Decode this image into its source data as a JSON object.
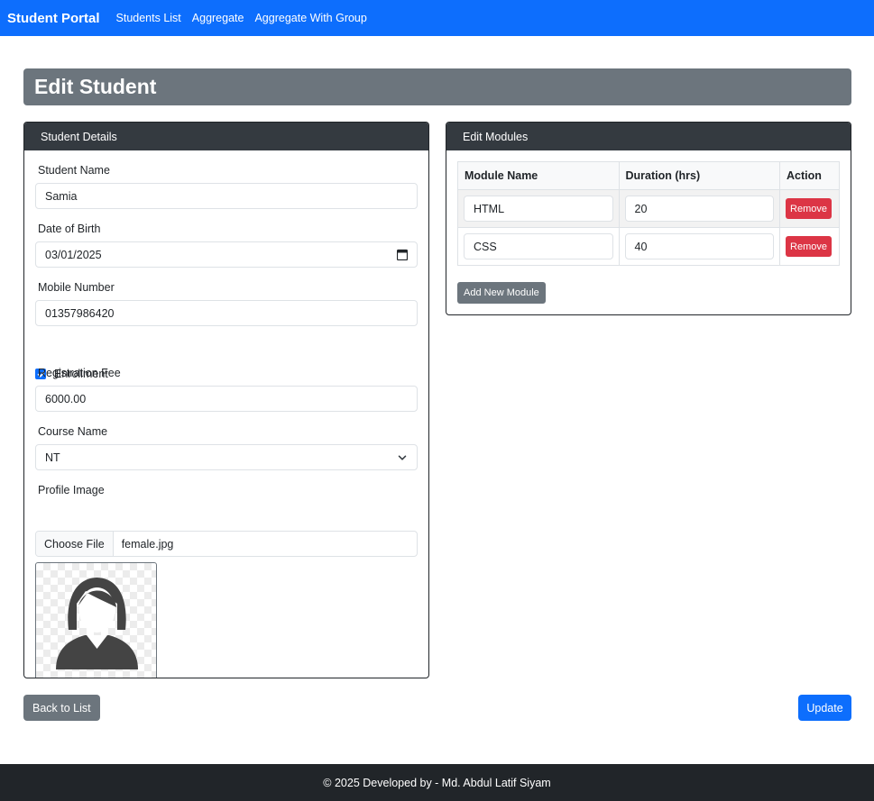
{
  "navbar": {
    "brand": "Student Portal",
    "links": [
      "Students List",
      "Aggregate",
      "Aggregate With Group"
    ]
  },
  "page_title": "Edit Student",
  "student_details": {
    "header": "Student Details",
    "name_label": "Student Name",
    "name_value": "Samia",
    "dob_label": "Date of Birth",
    "dob_value": "03/01/2025",
    "mobile_label": "Mobile Number",
    "mobile_value": "01357986420",
    "enrollment_label": "Enrollment",
    "enrollment_checked": true,
    "fee_label": "Registration Fee",
    "fee_value": "6000.00",
    "course_label": "Course Name",
    "course_value": "NT",
    "image_label": "Profile Image",
    "choose_file_label": "Choose File",
    "file_name": "female.jpg"
  },
  "modules": {
    "header": "Edit Modules",
    "columns": [
      "Module Name",
      "Duration (hrs)",
      "Action"
    ],
    "rows": [
      {
        "name": "HTML",
        "duration": "20",
        "action": "Remove"
      },
      {
        "name": "CSS",
        "duration": "40",
        "action": "Remove"
      }
    ],
    "add_label": "Add New Module"
  },
  "actions": {
    "back_label": "Back to List",
    "update_label": "Update"
  },
  "footer": "© 2025 Developed by - Md. Abdul Latif Siyam",
  "colors": {
    "primary": "#0d6efd",
    "secondary": "#6c757d",
    "danger": "#dc3545",
    "dark": "#343a40",
    "footer": "#212529"
  }
}
